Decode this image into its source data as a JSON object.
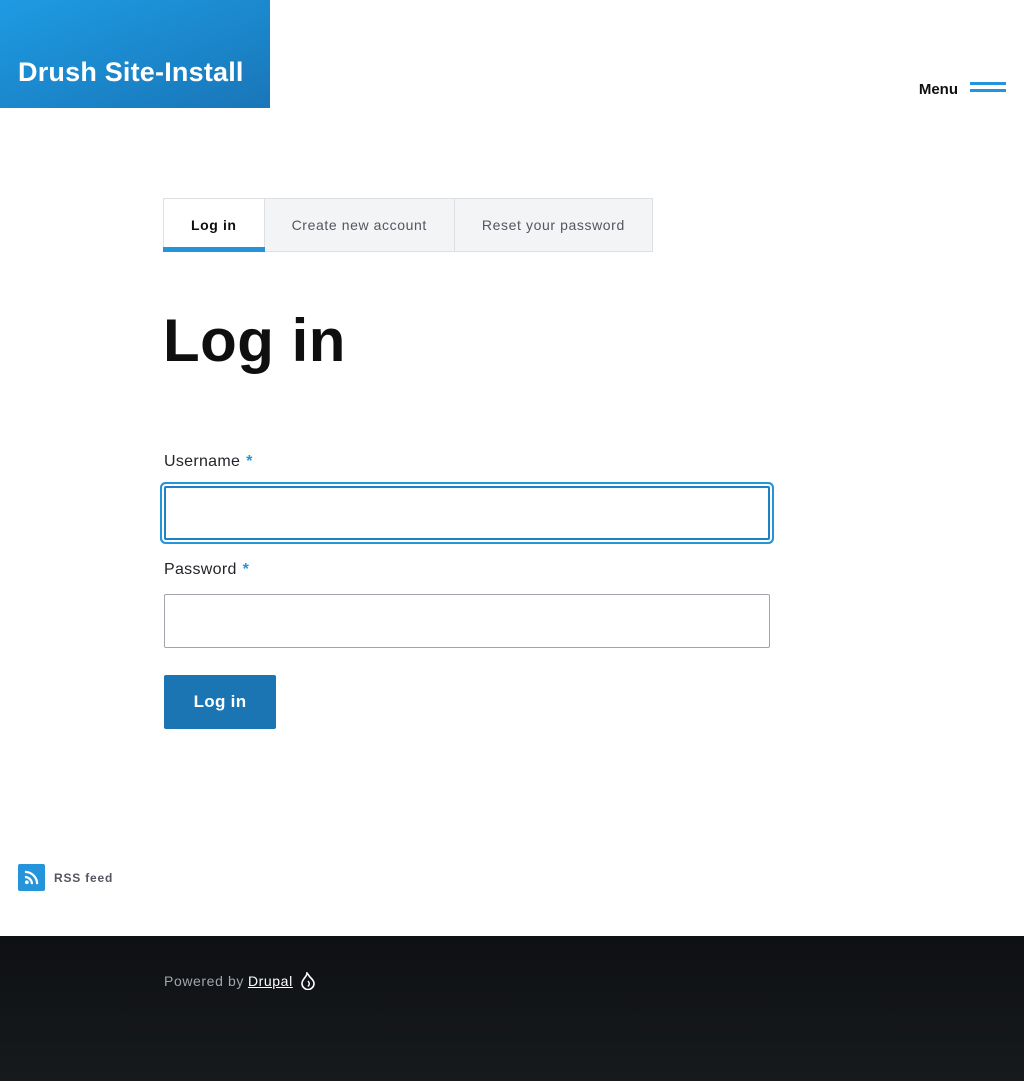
{
  "site": {
    "name": "Drush Site-Install"
  },
  "header": {
    "menu_label": "Menu"
  },
  "tabs": [
    {
      "label": "Log in",
      "active": true
    },
    {
      "label": "Create new account",
      "active": false
    },
    {
      "label": "Reset your password",
      "active": false
    }
  ],
  "page": {
    "title": "Log in"
  },
  "form": {
    "username": {
      "label": "Username",
      "required_marker": "*",
      "value": ""
    },
    "password": {
      "label": "Password",
      "required_marker": "*",
      "value": ""
    },
    "submit_label": "Log in"
  },
  "feed": {
    "label": "RSS feed",
    "icon": "rss-icon"
  },
  "footer": {
    "powered_by": "Powered by",
    "link_text": "Drupal",
    "icon": "drupal-drop-icon"
  },
  "colors": {
    "brand_blue": "#2494db",
    "button_blue": "#1b75b3",
    "footer_bg": "#14171a"
  }
}
